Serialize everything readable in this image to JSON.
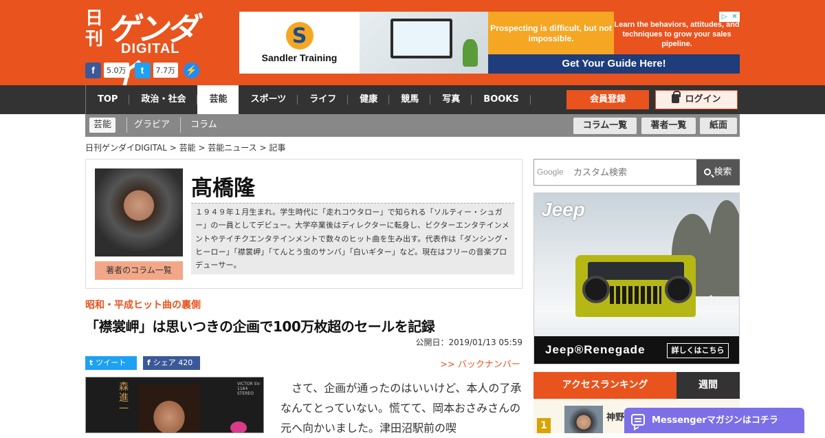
{
  "header": {
    "logo_nikkan": "日刊",
    "logo_main": "ゲンダイ",
    "logo_sub": "DIGITAL",
    "facebook_count": "5.0万",
    "twitter_count": "7.7万",
    "facebook_icon": "facebook-icon",
    "twitter_icon": "twitter-icon",
    "messenger_icon": "messenger-icon"
  },
  "ad": {
    "brand": "Sandler Training",
    "mid_text": "Prospecting is difficult, but not impossible.",
    "right_text": "Learn the behaviors, attitudes, and techniques to grow your sales pipeline.",
    "cta": "Get Your Guide Here!",
    "adchoices_icon": "adchoices-icon",
    "close_icon": "close-icon"
  },
  "nav": {
    "items": [
      {
        "label": "TOP"
      },
      {
        "label": "政治・社会"
      },
      {
        "label": "芸能"
      },
      {
        "label": "スポーツ"
      },
      {
        "label": "ライフ"
      },
      {
        "label": "健康"
      },
      {
        "label": "競馬"
      },
      {
        "label": "写真"
      },
      {
        "label": "BOOKS"
      }
    ],
    "register": "会員登録",
    "login": "ログイン"
  },
  "subnav": {
    "items": [
      "芸能",
      "グラビア",
      "コラム"
    ],
    "buttons": [
      "コラム一覧",
      "著者一覧",
      "紙面"
    ]
  },
  "breadcrumb": "日刊ゲンダイDIGITAL > 芸能 > 芸能ニュース > 記事",
  "author": {
    "name": "髙橋隆",
    "columns_button": "著者のコラム一覧",
    "bio": "１９４９年１月生まれ。学生時代に「走れコウタロー」で知られる「ソルティー・シュガー」の一員としてデビュー。大学卒業後はディレクターに転身し、ビクターエンタテインメントやテイチクエンタテインメントで数々のヒット曲を生み出す。代表作は「ダンシング・ヒーロー」「襟裳岬」「てんとう虫のサンバ」「白いギター」など。現在はフリーの音楽プロデューサー。"
  },
  "article": {
    "series": "昭和・平成ヒット曲の裏側",
    "title": "「襟裳岬」は思いつきの企画で100万枚超のセールを記録",
    "published": "公開日：2019/01/13 05:59",
    "tweet": "ツイート",
    "share": "シェア 420",
    "backnumber": ">> バックナンバー",
    "album_text": "森進一",
    "album_label": "VICTOR SV-1164 STEREO",
    "body": "さて、企画が通ったのはいいけど、本人の了承なんてとっていない。慌てて、岡本おさみさんの元へ向かいました。津田沼駅前の喫"
  },
  "sidebar": {
    "search_placeholder": "カスタム検索",
    "google_label": "Google",
    "search_button": "検索",
    "jeep_logo": "Jeep",
    "jeep_model": "Jeep®Renegade",
    "jeep_button": "詳しくはこちら",
    "ranking_title": "アクセスランキング",
    "ranking_tab": "週間",
    "rank1_num": "1",
    "rank1_text": "神野 五輪"
  },
  "messenger": {
    "label": "Messengerマガジンはコチラ"
  },
  "colors": {
    "brand": "#e9531e",
    "nav": "#333333",
    "facebook": "#3b5998",
    "twitter": "#1da1f2",
    "messenger": "#7c6fe8"
  }
}
